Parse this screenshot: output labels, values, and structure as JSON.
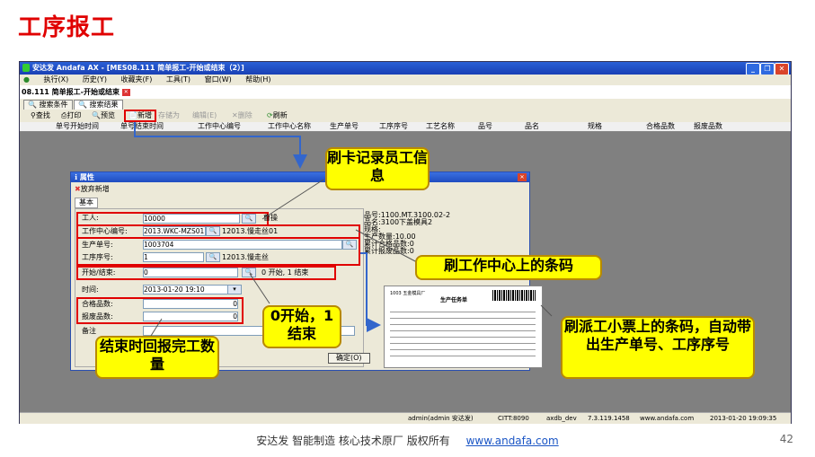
{
  "slide": {
    "title": "工序报工",
    "page_number": "42"
  },
  "footer": {
    "company_text": "安达发  智能制造 核心技术原厂   版权所有",
    "link": "www.andafa.com"
  },
  "window": {
    "title": "安达发  Andafa AX  - [MES08.111  简单报工-开始或结束（2）]",
    "document_tab": "08.111  简单报工-开始或结束"
  },
  "menu": [
    "执行(X)",
    "历史(Y)",
    "收藏夹(F)",
    "工具(T)",
    "窗口(W)",
    "帮助(H)"
  ],
  "tabs": [
    "搜索条件",
    "搜索结果"
  ],
  "toolbar": {
    "find": "查找",
    "print": "打印",
    "preview": "预览",
    "new": "新增",
    "save": "存储为",
    "edit": "编辑(E)",
    "delete": "删除",
    "refresh": "刷新"
  },
  "grid_columns": [
    "单号开始时间",
    "单号结束时间",
    "工作中心编号",
    "工作中心名称",
    "生产单号",
    "工序序号",
    "工艺名称",
    "品号",
    "品名",
    "规格",
    "合格品数",
    "报废品数"
  ],
  "dialog": {
    "title": "属性",
    "cancel_new": "放弃新增",
    "tab": "基本",
    "worker_label": "工人:",
    "worker_value": "10000",
    "worker_name": "曹操",
    "wc_label": "工作中心编号:",
    "wc_value": "2013.WKC-MZS01",
    "wc_name": "12013.慢走丝01",
    "order_label": "生产单号:",
    "order_value": "1003704",
    "op_label": "工序序号:",
    "op_value": "1",
    "op_name": "12013.慢走丝",
    "startend_label": "开始/结束:",
    "startend_value": "0",
    "startend_hint": "0 开始, 1 结束",
    "time_label": "时间:",
    "time_value": "2013-01-20 19:10",
    "good_label": "合格品数:",
    "good_value": "0",
    "scrap_label": "报废品数:",
    "scrap_value": "0",
    "remark_label": "备注",
    "info_lines": [
      "品号:1100.MT.3100.02-2",
      "品名:3100下盖模具2",
      "规格:",
      "生产数量:10.00",
      "累计合格品数:0",
      "累计报废品数:0"
    ],
    "ok_button": "确定(O)"
  },
  "callouts": {
    "swipe_card": "刷卡记录员工信息",
    "swipe_wc": "刷工作中心上的条码",
    "start_end": "0开始，1结束",
    "finish_qty": "结束时回报完工数量",
    "swipe_ticket": "刷派工小票上的条码，自动带出生产单号、工序序号"
  },
  "ticket": {
    "company": "1003 五金模具厂",
    "title": "生产任务单"
  },
  "statusbar": {
    "user": "admin(admin 安达发)",
    "cit": "CITT:8090",
    "db": "axdb_dev",
    "ip": "7.3.119.1458",
    "site": "www.andafa.com",
    "datetime": "2013-01-20 19:09:35"
  },
  "colors": {
    "title_red": "#e00000",
    "callout_yellow": "#ffff00",
    "highlight_red": "#e00000",
    "arrow_blue": "#3366cc"
  }
}
